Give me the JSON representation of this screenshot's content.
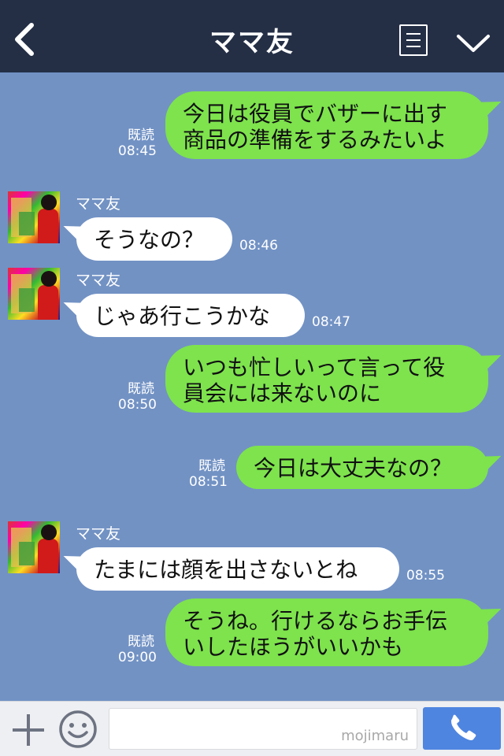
{
  "header": {
    "title": "ママ友",
    "back_icon": "chevron-left-icon",
    "menu_icon": "menu-list-icon",
    "collapse_icon": "chevron-down-icon",
    "background": "#242f46"
  },
  "chat": {
    "background": "#7292c4",
    "sent_bubble_color": "#7ee34d",
    "received_bubble_color": "#ffffff",
    "messages": [
      {
        "from": "me",
        "text": "今日は役員でバザーに出す\n商品の準備をするみたいよ",
        "read": "既読",
        "time": "08:45"
      },
      {
        "from": "them",
        "sender": "ママ友",
        "text": "そうなの？",
        "time": "08:46"
      },
      {
        "from": "them",
        "sender": "ママ友",
        "text": "じゃあ行こうかな",
        "time": "08:47"
      },
      {
        "from": "me",
        "text": "いつも忙しいって言って役\n員会には来ないのに",
        "read": "既読",
        "time": "08:50"
      },
      {
        "from": "me",
        "text": "今日は大丈夫なの？",
        "read": "既読",
        "time": "08:51"
      },
      {
        "from": "them",
        "sender": "ママ友",
        "text": "たまには顔を出さないとね",
        "time": "08:55"
      },
      {
        "from": "me",
        "text": "そうね。行けるならお手伝\nいしたほうがいいかも",
        "read": "既読",
        "time": "09:00"
      }
    ]
  },
  "input_bar": {
    "plus_icon": "plus-icon",
    "emoji_icon": "smiley-icon",
    "watermark": "mojimaru",
    "call_icon": "phone-icon",
    "call_button_color": "#4e85e0"
  }
}
